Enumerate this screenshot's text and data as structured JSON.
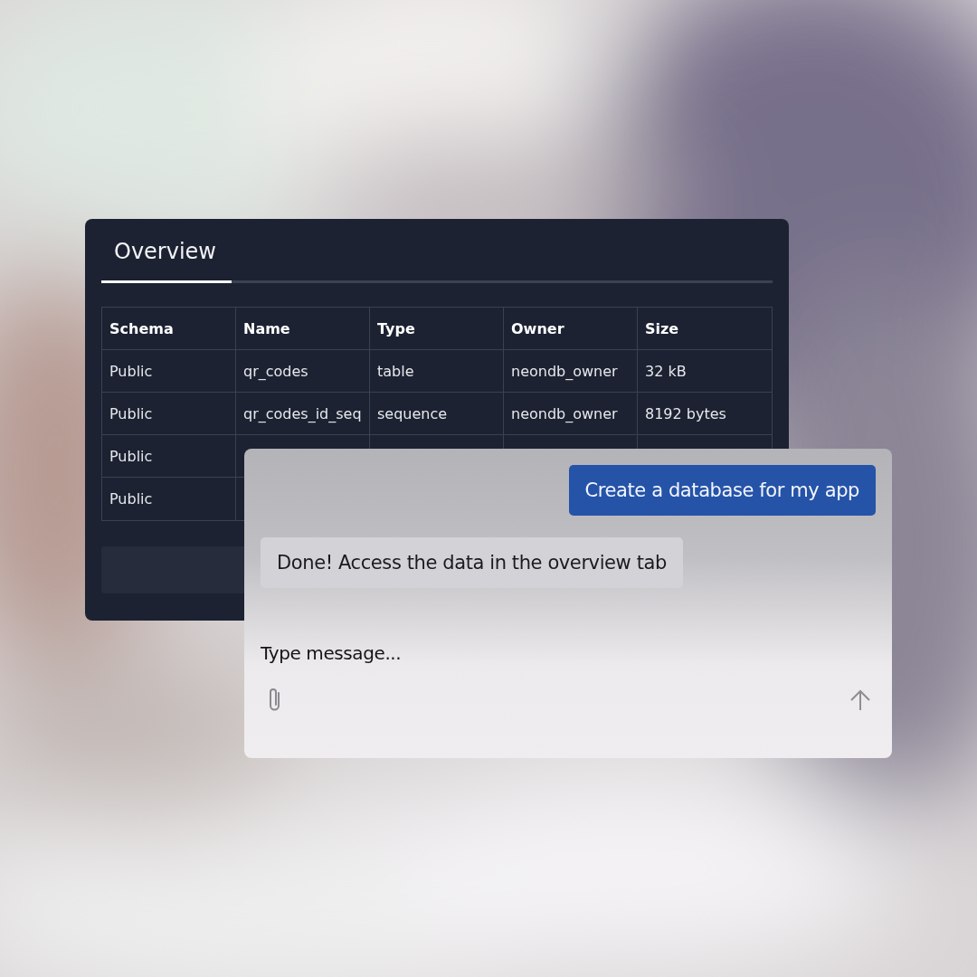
{
  "overview_panel": {
    "tabs": [
      {
        "label": "Overview",
        "selected": true
      }
    ],
    "table": {
      "columns": [
        "Schema",
        "Name",
        "Type",
        "Owner",
        "Size"
      ],
      "rows": [
        [
          "Public",
          "qr_codes",
          "table",
          "neondb_owner",
          "32 kB"
        ],
        [
          "Public",
          "qr_codes_id_seq",
          "sequence",
          "neondb_owner",
          "8192 bytes"
        ],
        [
          "Public"
        ],
        [
          "Public"
        ]
      ]
    }
  },
  "chat": {
    "messages": [
      {
        "kind": "outgoing",
        "text": "Create a database for my app"
      },
      {
        "kind": "incoming",
        "text": "Done! Access the data in the overview tab"
      }
    ],
    "input": {
      "placeholder": "Type message..."
    }
  }
}
